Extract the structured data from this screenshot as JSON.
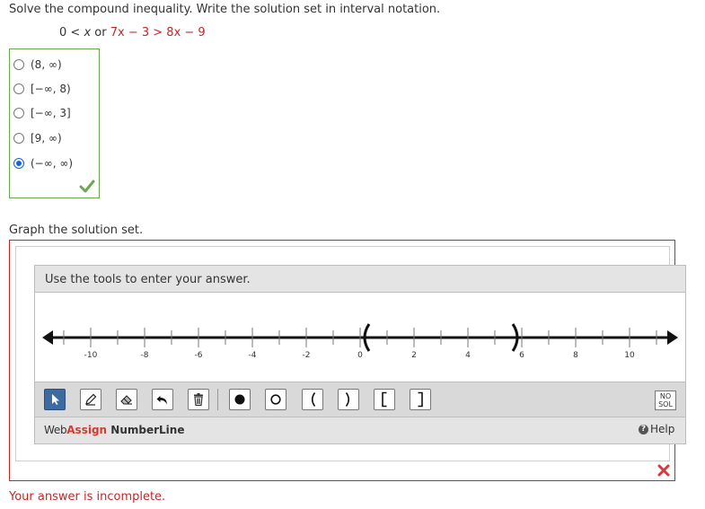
{
  "question": {
    "prompt": "Solve the compound inequality. Write the solution set in interval notation.",
    "inequality": {
      "left_part": "0 < ",
      "var1": "x",
      "connector": " or ",
      "var2": "7x",
      "middle": " − 3",
      "comparator": " > ",
      "right": "8x − 9"
    }
  },
  "options": [
    {
      "label": "(8, ∞)",
      "selected": false
    },
    {
      "label": "[−∞, 8)",
      "selected": false
    },
    {
      "label": "[−∞, 3]",
      "selected": false
    },
    {
      "label": "[9, ∞)",
      "selected": false
    },
    {
      "label": "(−∞, ∞)",
      "selected": true
    }
  ],
  "graph_section": {
    "label": "Graph the solution set.",
    "instructions": "Use the tools to enter your answer.",
    "number_line": {
      "min": -12,
      "max": 12,
      "tick_labels": [
        "-10",
        "-8",
        "-6",
        "-4",
        "-2",
        "0",
        "2",
        "4",
        "6",
        "8",
        "10"
      ],
      "plotted": [
        {
          "value": 0.2,
          "symbol": "("
        },
        {
          "value": 5.8,
          "symbol": ")"
        }
      ]
    },
    "tools": [
      {
        "name": "select-arrow-icon"
      },
      {
        "name": "pencil-icon"
      },
      {
        "name": "eraser-icon"
      },
      {
        "name": "undo-icon"
      },
      {
        "name": "trash-icon"
      },
      {
        "name": "closed-dot-icon"
      },
      {
        "name": "open-dot-icon"
      },
      {
        "name": "left-paren-icon",
        "glyph": "("
      },
      {
        "name": "right-paren-icon",
        "glyph": ")"
      },
      {
        "name": "left-bracket-icon",
        "glyph": "["
      },
      {
        "name": "right-bracket-icon",
        "glyph": "]"
      }
    ],
    "no_solution": {
      "line1": "NO",
      "line2": "SOL"
    },
    "brand": {
      "web": "Web",
      "assign": "Assign",
      "product": "NumberLine"
    },
    "help": "Help"
  },
  "status": "Your answer is incomplete.",
  "colors": {
    "accent": "#1565d8",
    "error": "#c0282a",
    "correct": "#6aa84f"
  }
}
